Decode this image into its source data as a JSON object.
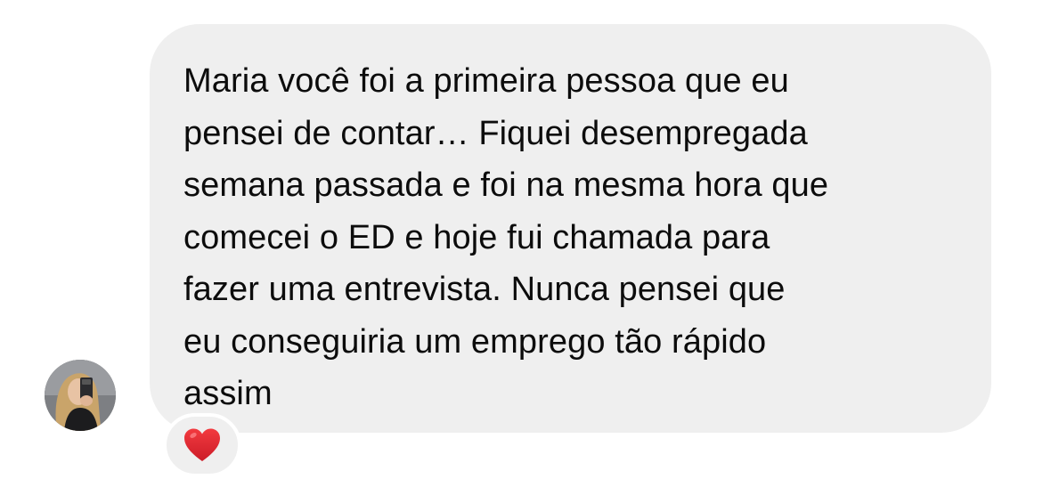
{
  "message": {
    "text": "Maria você foi a primeira pessoa que eu\npensei de contar… Fiquei desempregada\nsemana passada e foi na mesma hora que\ncomecei o ED e hoje fui chamada para\nfazer uma entrevista. Nunca pensei que\neu conseguiria um emprego tão rápido\nassim"
  },
  "reaction": {
    "icon": "red-heart-icon",
    "color": "#e0242e"
  },
  "colors": {
    "bubble_background": "#efefef",
    "text": "#0c0c0c",
    "page_background": "#ffffff"
  }
}
